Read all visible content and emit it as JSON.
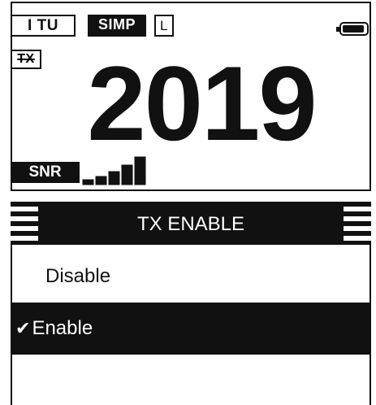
{
  "status_bar": {
    "mode_tag": "I TU",
    "simplex_tag": "SIMP",
    "power_tag": "L",
    "tx_tag": "TX",
    "battery_icon": "battery-full-icon"
  },
  "display": {
    "channel_number": "2019"
  },
  "signal": {
    "snr_label": "SNR",
    "snr_level": 5,
    "snr_max": 5
  },
  "menu": {
    "title": "TX ENABLE",
    "options": [
      {
        "label": "Disable",
        "selected": false
      },
      {
        "label": "Enable",
        "selected": true
      }
    ],
    "check_mark": "✔"
  },
  "colors": {
    "foreground": "#111111",
    "background": "#ffffff"
  }
}
